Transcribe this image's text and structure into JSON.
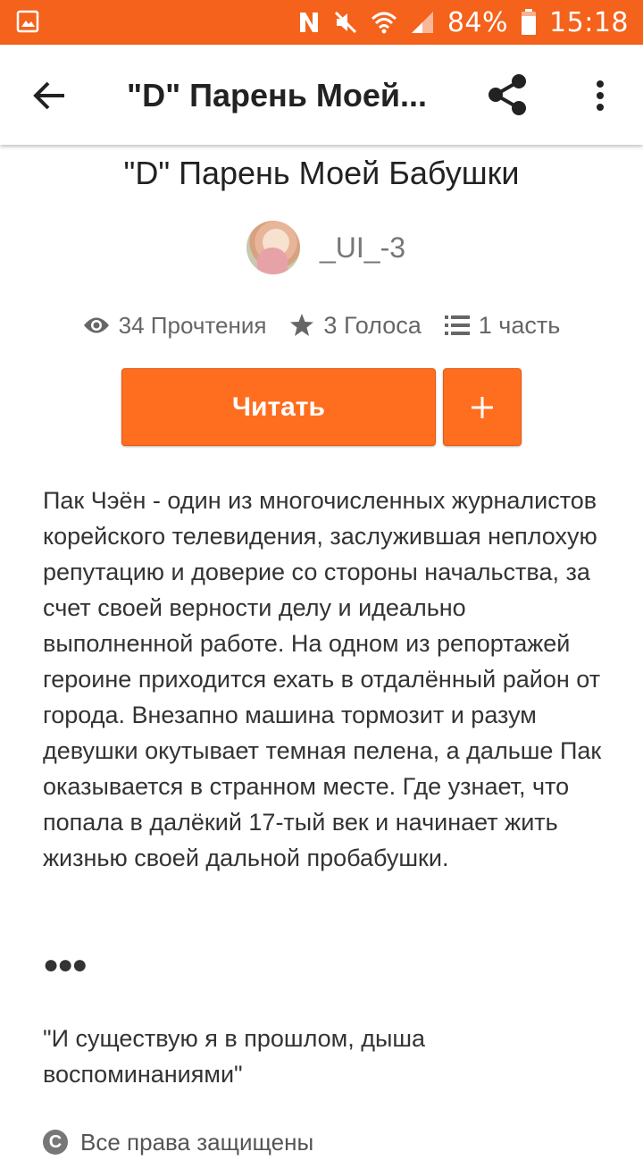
{
  "status_bar": {
    "battery": "84%",
    "time": "15:18",
    "icons": [
      "gallery-notification-icon",
      "nfc-icon",
      "mute-icon",
      "wifi-icon",
      "signal-icon",
      "battery-icon"
    ]
  },
  "app_bar": {
    "title": "\"D\" Парень Моей...",
    "icons": [
      "back-arrow-icon",
      "share-icon",
      "more-vert-icon"
    ]
  },
  "story": {
    "title": "\"D\" Парень Моей Бабушки",
    "author": "_UI_-3",
    "stats": {
      "reads": "34 Прочтения",
      "votes": "3 Голоса",
      "parts": "1 часть"
    },
    "read_button": "Читать",
    "description": "Пак Чэён - один из многочисленных журналистов корейского телевидения, заслужившая неплохую репутацию и доверие со стороны начальства, за счет своей верности делу и идеально выполненной работе. На одном из репортажей героине приходится ехать в отдалённый район от города. Внезапно машина тормозит и разум девушки окутывает темная пелена, а дальше Пак оказывается в странном месте. Где узнает, что попала в далёкий 17-тый век и начинает жить жизнью своей дальной пробабушки.",
    "separator": "●●●",
    "quote": "\"И существую я в прошлом, дыша воспоминаниями\"",
    "copyright": "Все права защищены"
  },
  "colors": {
    "accent": "#f4621c",
    "button": "#ff6d1f"
  }
}
